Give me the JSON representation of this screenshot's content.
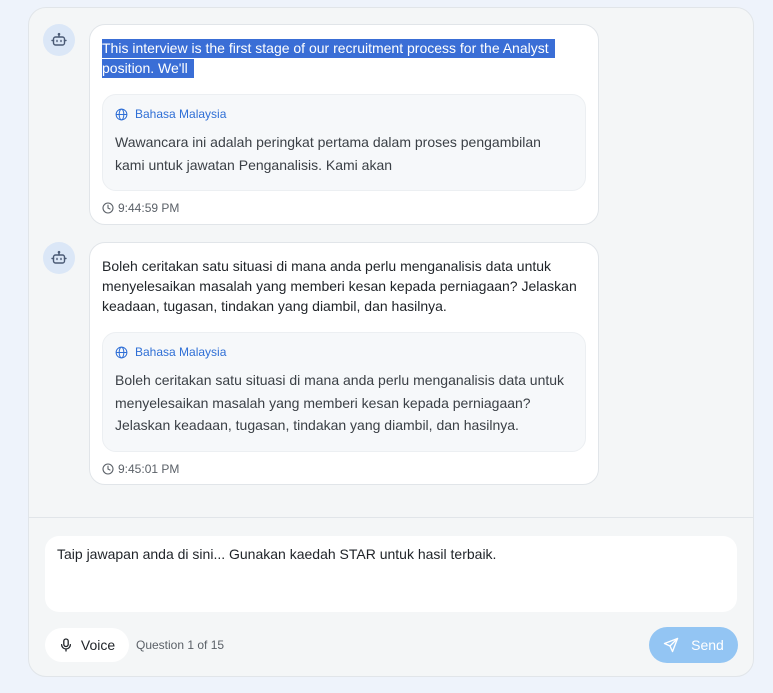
{
  "messages": [
    {
      "text": "This interview is the first stage of our recruitment process for the Analyst position. We'll",
      "translation_language": "Bahasa Malaysia",
      "translation_text": "Wawancara ini adalah peringkat pertama dalam proses pengambilan kami untuk jawatan Penganalisis. Kami akan",
      "time": "9:44:59 PM"
    },
    {
      "text": "Boleh ceritakan satu situasi di mana anda perlu menganalisis data untuk menyelesaikan masalah yang memberi kesan kepada perniagaan? Jelaskan keadaan, tugasan, tindakan yang diambil, dan hasilnya.",
      "translation_language": "Bahasa Malaysia",
      "translation_text": "Boleh ceritakan satu situasi di mana anda perlu menganalisis data untuk menyelesaikan masalah yang memberi kesan kepada perniagaan? Jelaskan keadaan, tugasan, tindakan yang diambil, dan hasilnya.",
      "time": "9:45:01 PM"
    }
  ],
  "input": {
    "placeholder": "Taip jawapan anda di sini... Gunakan kaedah STAR untuk hasil terbaik."
  },
  "footer": {
    "voice_label": "Voice",
    "question_count": "Question 1 of 15",
    "send_label": "Send"
  },
  "icons": {
    "avatar": "bot-icon",
    "language": "globe-icon",
    "time": "clock-icon",
    "voice": "microphone-icon",
    "send": "send-icon"
  },
  "colors": {
    "accent": "#2f6fd6",
    "send_button": "#93c5f3",
    "selection": "#3a6ed6"
  }
}
